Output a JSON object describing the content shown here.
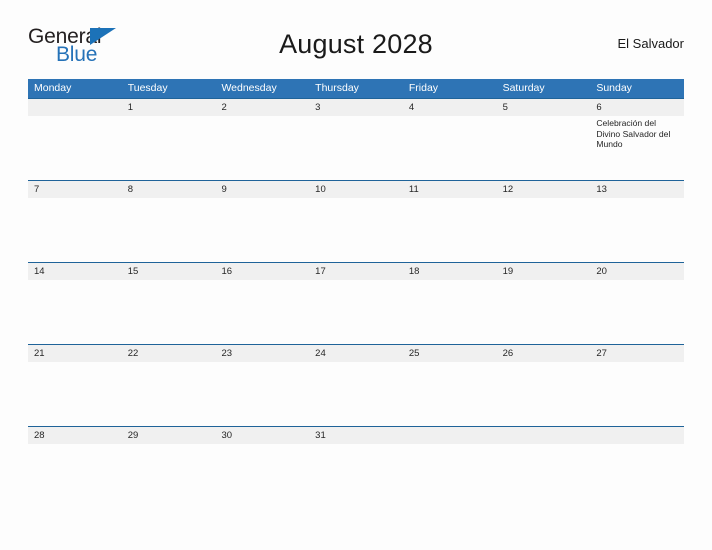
{
  "brand": {
    "name_part1": "General",
    "name_part2": "Blue",
    "flag_icon": "flag-triangle-icon",
    "color_dark": "#231f20",
    "color_blue": "#2572b8"
  },
  "header": {
    "title": "August 2028",
    "country": "El Salvador"
  },
  "theme": {
    "header_bar": "#2e74b5",
    "row_band": "#f0f0f0",
    "row_border": "#1f6399",
    "page_background": "#fdfdfd",
    "text": "#262626"
  },
  "calendar": {
    "month": "August",
    "year": "2028",
    "weekdays": [
      "Monday",
      "Tuesday",
      "Wednesday",
      "Thursday",
      "Friday",
      "Saturday",
      "Sunday"
    ],
    "weeks": [
      {
        "days": [
          {
            "date": "",
            "events": []
          },
          {
            "date": "1",
            "events": []
          },
          {
            "date": "2",
            "events": []
          },
          {
            "date": "3",
            "events": []
          },
          {
            "date": "4",
            "events": []
          },
          {
            "date": "5",
            "events": []
          },
          {
            "date": "6",
            "events": [
              "Celebración del Divino Salvador del Mundo"
            ]
          }
        ]
      },
      {
        "days": [
          {
            "date": "7",
            "events": []
          },
          {
            "date": "8",
            "events": []
          },
          {
            "date": "9",
            "events": []
          },
          {
            "date": "10",
            "events": []
          },
          {
            "date": "11",
            "events": []
          },
          {
            "date": "12",
            "events": []
          },
          {
            "date": "13",
            "events": []
          }
        ]
      },
      {
        "days": [
          {
            "date": "14",
            "events": []
          },
          {
            "date": "15",
            "events": []
          },
          {
            "date": "16",
            "events": []
          },
          {
            "date": "17",
            "events": []
          },
          {
            "date": "18",
            "events": []
          },
          {
            "date": "19",
            "events": []
          },
          {
            "date": "20",
            "events": []
          }
        ]
      },
      {
        "days": [
          {
            "date": "21",
            "events": []
          },
          {
            "date": "22",
            "events": []
          },
          {
            "date": "23",
            "events": []
          },
          {
            "date": "24",
            "events": []
          },
          {
            "date": "25",
            "events": []
          },
          {
            "date": "26",
            "events": []
          },
          {
            "date": "27",
            "events": []
          }
        ]
      },
      {
        "days": [
          {
            "date": "28",
            "events": []
          },
          {
            "date": "29",
            "events": []
          },
          {
            "date": "30",
            "events": []
          },
          {
            "date": "31",
            "events": []
          },
          {
            "date": "",
            "events": []
          },
          {
            "date": "",
            "events": []
          },
          {
            "date": "",
            "events": []
          }
        ]
      }
    ]
  }
}
